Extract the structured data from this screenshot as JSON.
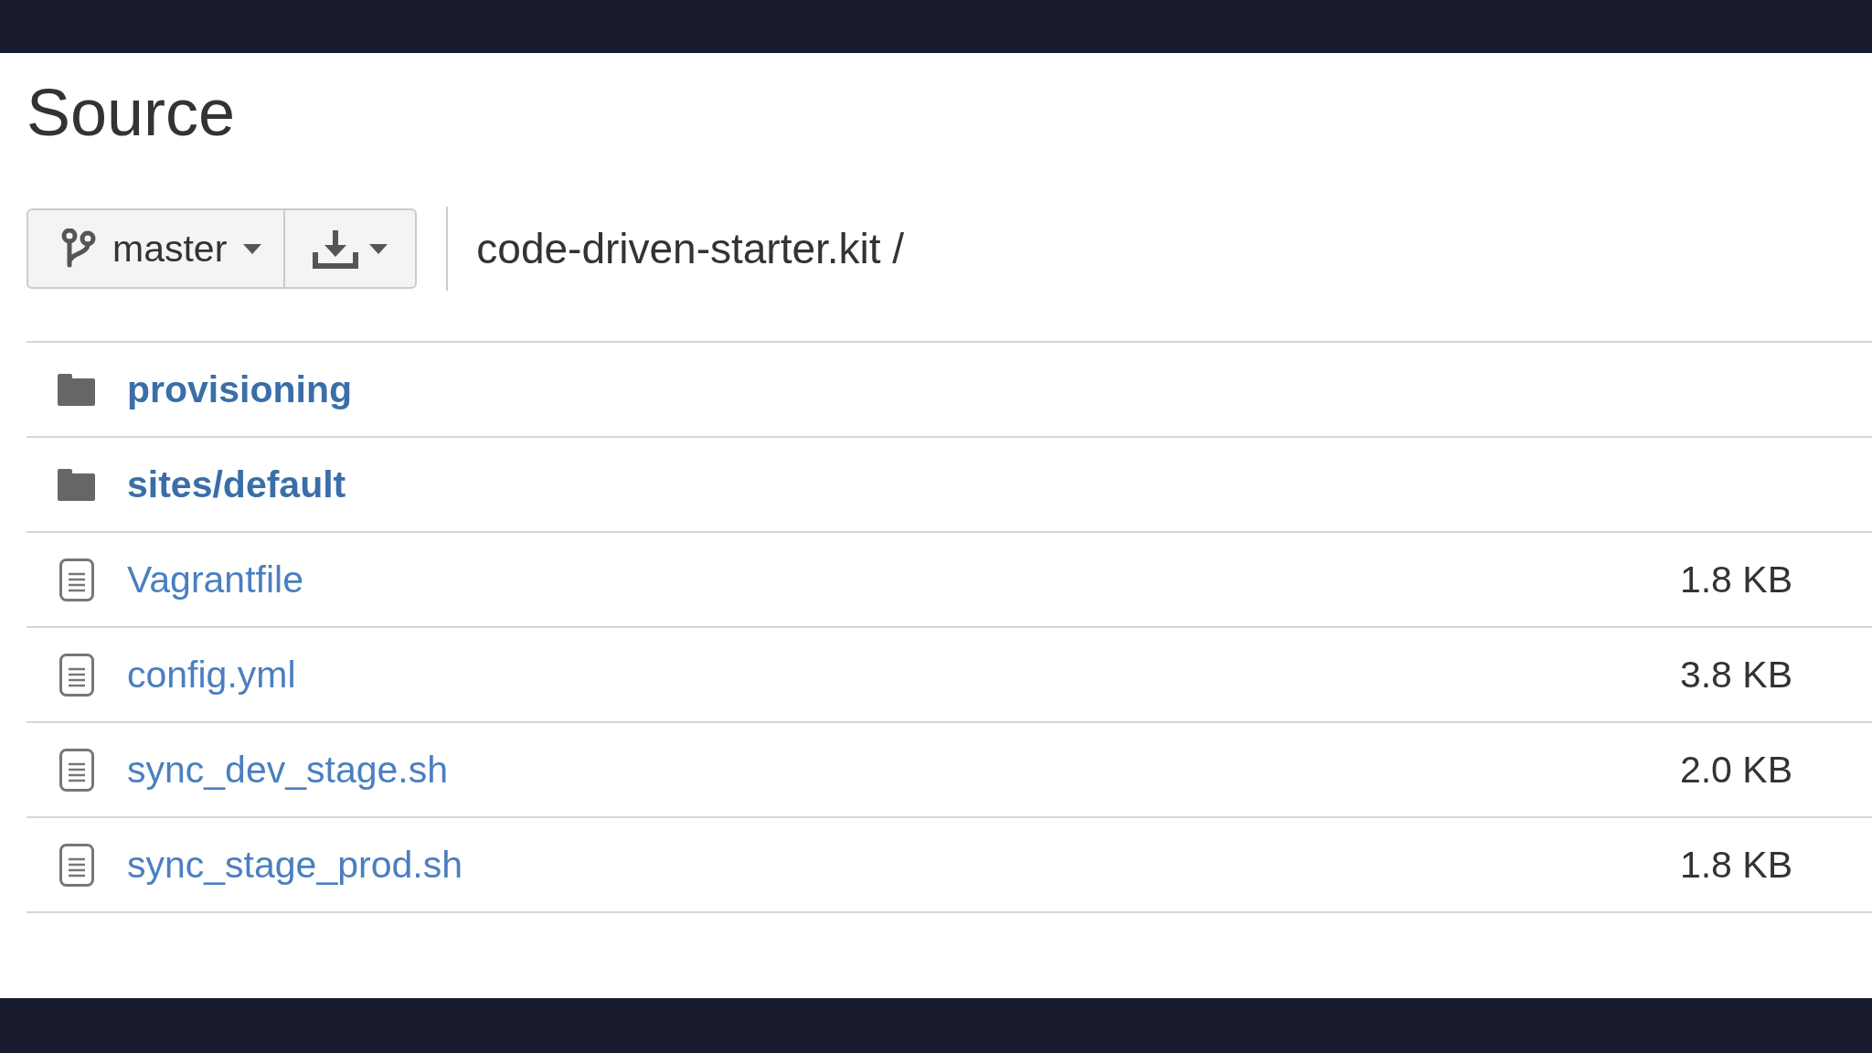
{
  "title": "Source",
  "toolbar": {
    "branch": "master",
    "breadcrumb": "code-driven-starter.kit /"
  },
  "files": [
    {
      "kind": "folder",
      "name": "provisioning"
    },
    {
      "kind": "folder",
      "name": "sites/default"
    },
    {
      "kind": "file",
      "name": "Vagrantfile",
      "size": "1.8 KB"
    },
    {
      "kind": "file",
      "name": "config.yml",
      "size": "3.8 KB"
    },
    {
      "kind": "file",
      "name": "sync_dev_stage.sh",
      "size": "2.0 KB"
    },
    {
      "kind": "file",
      "name": "sync_stage_prod.sh",
      "size": "1.8 KB"
    }
  ]
}
